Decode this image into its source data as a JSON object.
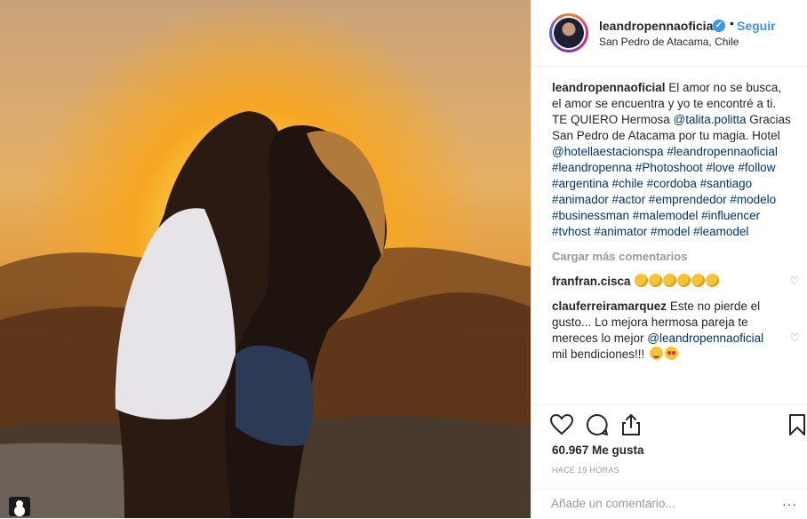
{
  "post": {
    "username": "leandropennaoficial",
    "follow_label": "Seguir",
    "separator": "•",
    "location": "San Pedro de Atacama, Chile"
  },
  "caption": {
    "author": "leandropennaoficial",
    "line1": " El amor no se busca, el amor se encuentra y yo te encontré a ti. TE QUIERO Hermosa ",
    "mention1": "@talita.politta",
    "line2": " Gracias San Pedro de Atacama por tu magia. Hotel ",
    "mention2": "@hotellaestacionspa",
    "hashtags": "#leandropennaoficial #leandropenna #Photoshoot #love #follow #argentina #chile #cordoba #santiago #animador #actor #emprendedor #modelo #businessman #malemodel #influencer #tvhost #animator #model #leamodel"
  },
  "load_more": "Cargar más comentarios",
  "comments": [
    {
      "user": "franfran.cisca",
      "text": "",
      "emoji": [
        "clap",
        "clap",
        "clap",
        "clap",
        "clap",
        "clap"
      ]
    },
    {
      "user": "clauferreiramarquez",
      "text": " Este no pierde el gusto... Lo mejora hermosa pareja te mereces lo mejor ",
      "mention": "@leandropennaoficial",
      "text2": " mil bendiciones!!! ",
      "emoji": [
        "smile",
        "hearts"
      ]
    }
  ],
  "stats": {
    "likes": "60.967 Me gusta",
    "time": "HACE 19 HORAS"
  },
  "input": {
    "placeholder": "Añade un comentario...",
    "options": "···"
  },
  "icons": [
    "heart-icon",
    "comment-icon",
    "share-icon",
    "bookmark-icon",
    "verified-icon",
    "user-tag-icon"
  ]
}
